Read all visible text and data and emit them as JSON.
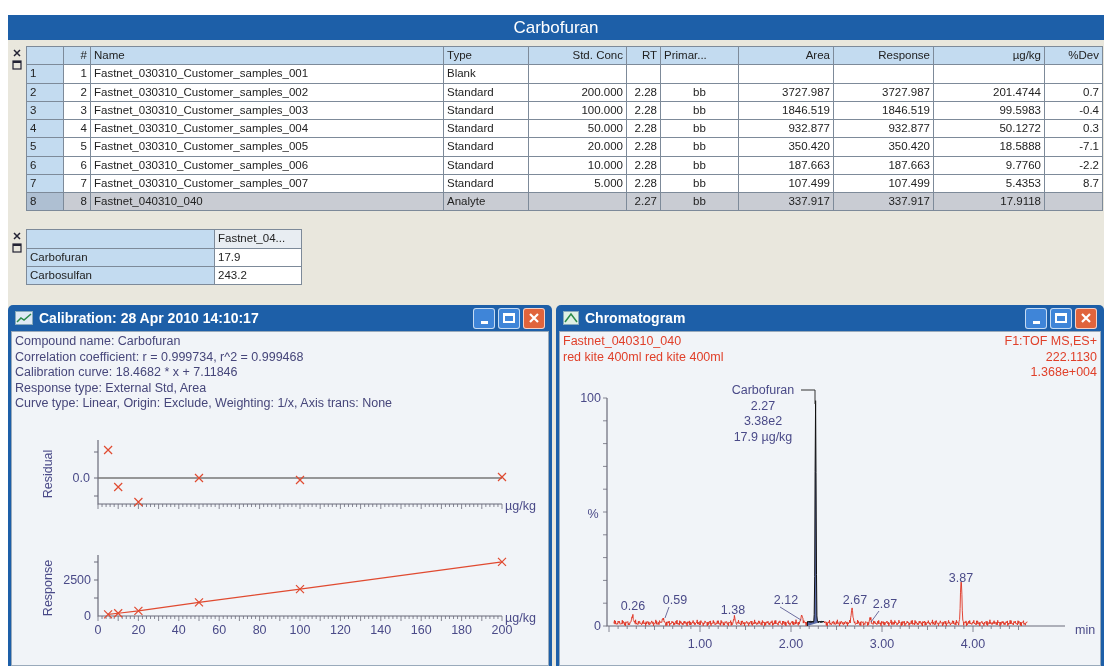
{
  "title": "Carbofuran",
  "results_table": {
    "columns": [
      "#",
      "Name",
      "Type",
      "Std. Conc",
      "RT",
      "Primar...",
      "Area",
      "Response",
      "µg/kg",
      "%Dev"
    ],
    "rows": [
      {
        "row_label": "1",
        "selected": false,
        "cells": [
          "1",
          "Fastnet_030310_Customer_samples_001",
          "Blank",
          "",
          "",
          "",
          "",
          "",
          "",
          ""
        ]
      },
      {
        "row_label": "2",
        "selected": false,
        "cells": [
          "2",
          "Fastnet_030310_Customer_samples_002",
          "Standard",
          "200.000",
          "2.28",
          "bb",
          "3727.987",
          "3727.987",
          "201.4744",
          "0.7"
        ]
      },
      {
        "row_label": "3",
        "selected": false,
        "cells": [
          "3",
          "Fastnet_030310_Customer_samples_003",
          "Standard",
          "100.000",
          "2.28",
          "bb",
          "1846.519",
          "1846.519",
          "99.5983",
          "-0.4"
        ]
      },
      {
        "row_label": "4",
        "selected": false,
        "cells": [
          "4",
          "Fastnet_030310_Customer_samples_004",
          "Standard",
          "50.000",
          "2.28",
          "bb",
          "932.877",
          "932.877",
          "50.1272",
          "0.3"
        ]
      },
      {
        "row_label": "5",
        "selected": false,
        "cells": [
          "5",
          "Fastnet_030310_Customer_samples_005",
          "Standard",
          "20.000",
          "2.28",
          "bb",
          "350.420",
          "350.420",
          "18.5888",
          "-7.1"
        ]
      },
      {
        "row_label": "6",
        "selected": false,
        "cells": [
          "6",
          "Fastnet_030310_Customer_samples_006",
          "Standard",
          "10.000",
          "2.28",
          "bb",
          "187.663",
          "187.663",
          "9.7760",
          "-2.2"
        ]
      },
      {
        "row_label": "7",
        "selected": false,
        "cells": [
          "7",
          "Fastnet_030310_Customer_samples_007",
          "Standard",
          "5.000",
          "2.28",
          "bb",
          "107.499",
          "107.499",
          "5.4353",
          "8.7"
        ]
      },
      {
        "row_label": "8",
        "selected": true,
        "cells": [
          "8",
          "Fastnet_040310_040",
          "Analyte",
          "",
          "2.27",
          "bb",
          "337.917",
          "337.917",
          "17.9118",
          ""
        ]
      }
    ]
  },
  "summary_table": {
    "columns": [
      "Fastnet_04..."
    ],
    "rows": [
      {
        "label": "Carbofuran",
        "cells": [
          "17.9"
        ]
      },
      {
        "label": "Carbosulfan",
        "cells": [
          "243.2"
        ]
      }
    ]
  },
  "calibration_window": {
    "title": "Calibration: 28 Apr 2010 14:10:17",
    "info": [
      "Compound name: Carbofuran",
      "Correlation coefficient: r = 0.999734, r^2 = 0.999468",
      "Calibration curve: 18.4682 * x + 7.11846",
      "Response type: External Std, Area",
      "Curve type: Linear, Origin: Exclude, Weighting: 1/x, Axis trans: None"
    ],
    "residual_plot": {
      "ylabel": "Residual",
      "ytick": "0.0",
      "xlabel": "µg/kg"
    },
    "response_plot": {
      "chart_data": {
        "type": "line",
        "xlabel": "µg/kg",
        "ylabel": "Response",
        "x": [
          5,
          10,
          20,
          50,
          100,
          200
        ],
        "series": [
          {
            "color": "#e04a30",
            "marker": "x",
            "values": [
              107,
              188,
              350,
              933,
              1847,
              3728
            ]
          }
        ],
        "xlim": [
          0,
          200
        ],
        "ylim": [
          0,
          4200
        ],
        "xticks": [
          0,
          20,
          40,
          60,
          80,
          100,
          120,
          140,
          160,
          180,
          200
        ],
        "yticks": [
          0,
          2500
        ]
      }
    }
  },
  "chromatogram_window": {
    "title": "Chromatogram",
    "sample": [
      "Fastnet_040310_040",
      "red kite 400ml red kite 400ml"
    ],
    "trace_info": [
      "F1:TOF MS,ES+",
      "222.1130",
      "1.368e+004"
    ],
    "peak_label": [
      "Carbofuran",
      "2.27",
      "3.38e2",
      "17.9 µg/kg"
    ],
    "peaks": [
      "0.26",
      "0.59",
      "1.38",
      "2.12",
      "2.67",
      "2.87",
      "3.87"
    ],
    "yticks": [
      "100",
      "0"
    ],
    "ylabel": "%",
    "xticks": [
      "1.00",
      "2.00",
      "3.00",
      "4.00"
    ],
    "xlabel": "min"
  }
}
